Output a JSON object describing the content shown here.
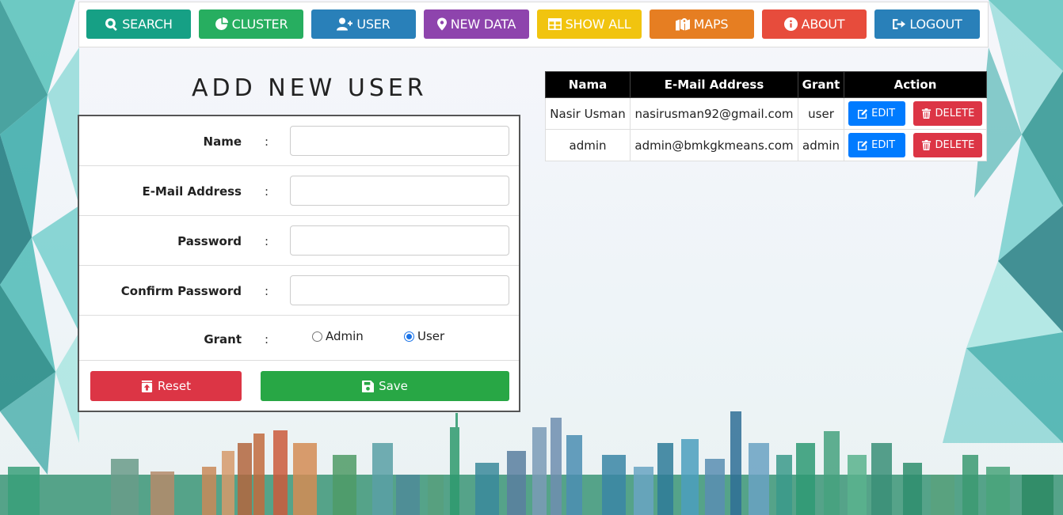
{
  "nav": {
    "items": [
      {
        "label": "SEARCH",
        "icon": "search-icon",
        "color": "#16a085"
      },
      {
        "label": "CLUSTER",
        "icon": "pie-chart-icon",
        "color": "#27ae60"
      },
      {
        "label": "USER",
        "icon": "user-plus-icon",
        "color": "#2980b9"
      },
      {
        "label": "NEW DATA",
        "icon": "map-marker-icon",
        "color": "#8e44ad"
      },
      {
        "label": "SHOW ALL",
        "icon": "table-icon",
        "color": "#f1c40f"
      },
      {
        "label": "MAPS",
        "icon": "map-icon",
        "color": "#e67e22"
      },
      {
        "label": "ABOUT",
        "icon": "info-circle-icon",
        "color": "#e74c3c"
      },
      {
        "label": "LOGOUT",
        "icon": "sign-out-icon",
        "color": "#2980b9"
      }
    ]
  },
  "page_title": "ADD NEW USER",
  "form": {
    "fields": [
      {
        "label": "Name",
        "value": "",
        "placeholder": ""
      },
      {
        "label": "E-Mail Address",
        "value": "",
        "placeholder": ""
      },
      {
        "label": "Password",
        "value": "",
        "placeholder": ""
      },
      {
        "label": "Confirm Password",
        "value": "",
        "placeholder": ""
      }
    ],
    "colon": ":",
    "grant": {
      "label": "Grant",
      "options": [
        "Admin",
        "User"
      ],
      "selected": "User"
    },
    "reset_label": "Reset",
    "save_label": "Save",
    "reset_color": "#dc3545",
    "save_color": "#28a745"
  },
  "table": {
    "headers": [
      "Nama",
      "E-Mail Address",
      "Grant",
      "Action"
    ],
    "rows": [
      {
        "nama": "Nasir Usman",
        "email": "nasirusman92@gmail.com",
        "grant": "user"
      },
      {
        "nama": "admin",
        "email": "admin@bmkgkmeans.com",
        "grant": "admin"
      }
    ],
    "edit_label": "EDIT",
    "delete_label": "DELETE",
    "edit_color": "#007bff",
    "delete_color": "#dc3545"
  }
}
